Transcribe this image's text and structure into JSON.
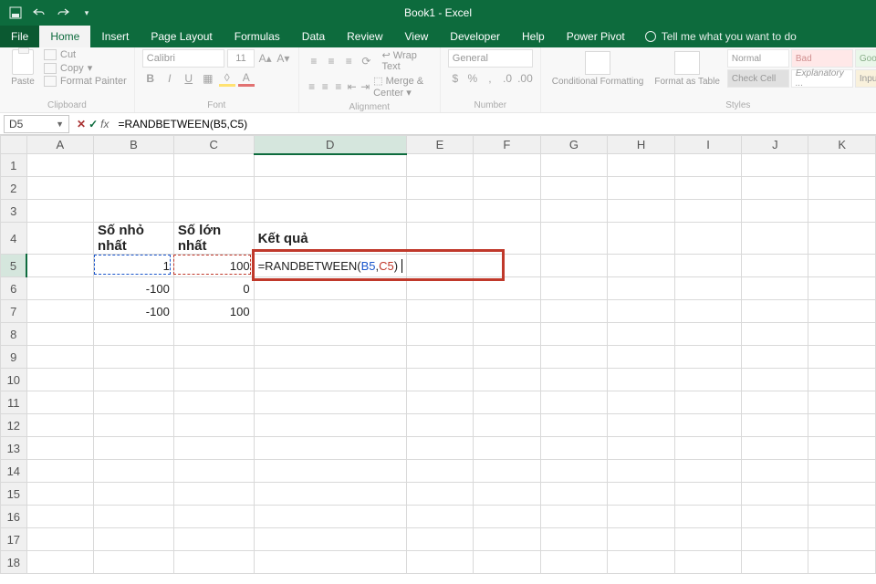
{
  "title": "Book1 - Excel",
  "tabs": {
    "file": "File",
    "home": "Home",
    "insert": "Insert",
    "pagelayout": "Page Layout",
    "formulas": "Formulas",
    "data": "Data",
    "review": "Review",
    "view": "View",
    "developer": "Developer",
    "help": "Help",
    "powerpivot": "Power Pivot",
    "tellme": "Tell me what you want to do"
  },
  "ribbon": {
    "clipboard": {
      "paste": "Paste",
      "cut": "Cut",
      "copy": "Copy",
      "painter": "Format Painter",
      "label": "Clipboard"
    },
    "font": {
      "name": "Calibri",
      "size": "11",
      "label": "Font"
    },
    "alignment": {
      "wrap": "Wrap Text",
      "merge": "Merge & Center",
      "label": "Alignment"
    },
    "number": {
      "format": "General",
      "label": "Number"
    },
    "styles": {
      "cond": "Conditional Formatting",
      "table": "Format as Table",
      "normal": "Normal",
      "bad": "Bad",
      "good": "Good",
      "check": "Check Cell",
      "expl": "Explanatory ...",
      "input": "Input",
      "label": "Styles"
    }
  },
  "namebox": "D5",
  "formula": "=RANDBETWEEN(B5,C5)",
  "columns": [
    "A",
    "B",
    "C",
    "D",
    "E",
    "F",
    "G",
    "H",
    "I",
    "J",
    "K"
  ],
  "rows": [
    "1",
    "2",
    "3",
    "4",
    "5",
    "6",
    "7",
    "8",
    "9",
    "10",
    "11",
    "12",
    "13",
    "14",
    "15",
    "16",
    "17",
    "18"
  ],
  "sheet": {
    "h_b": "Số nhỏ nhất",
    "h_c": "Số lớn nhất",
    "h_d": "Kết quả",
    "b5": "1",
    "c5": "100",
    "b6": "-100",
    "c6": "0",
    "b7": "-100",
    "c7": "100",
    "d5_formula_prefix": "=RANDBETWEEN(",
    "d5_ref_b": "B5",
    "d5_comma": ",",
    "d5_ref_c": "C5",
    "d5_suffix": ")"
  }
}
